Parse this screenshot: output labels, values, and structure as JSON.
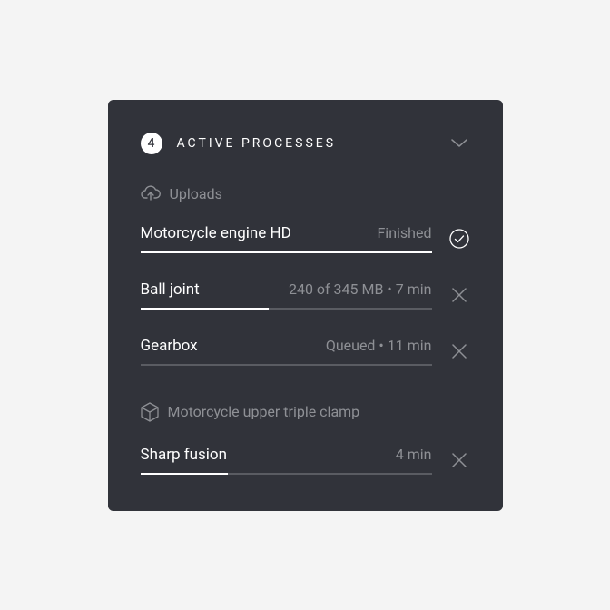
{
  "header": {
    "count": "4",
    "title": "ACTIVE PROCESSES"
  },
  "sections": {
    "uploads": {
      "label": "Uploads",
      "items": [
        {
          "name": "Motorcycle engine HD",
          "status": "Finished",
          "progress": 100,
          "action": "done"
        },
        {
          "name": "Ball joint",
          "status": "240 of 345 MB  •  7 min",
          "progress": 44,
          "action": "cancel"
        },
        {
          "name": "Gearbox",
          "status": "Queued  •  11 min",
          "progress": 0,
          "action": "cancel"
        }
      ]
    },
    "ai": {
      "label": "Motorcycle upper triple clamp",
      "items": [
        {
          "name": "Sharp fusion",
          "status": "4 min",
          "progress": 30,
          "action": "cancel"
        }
      ]
    }
  }
}
